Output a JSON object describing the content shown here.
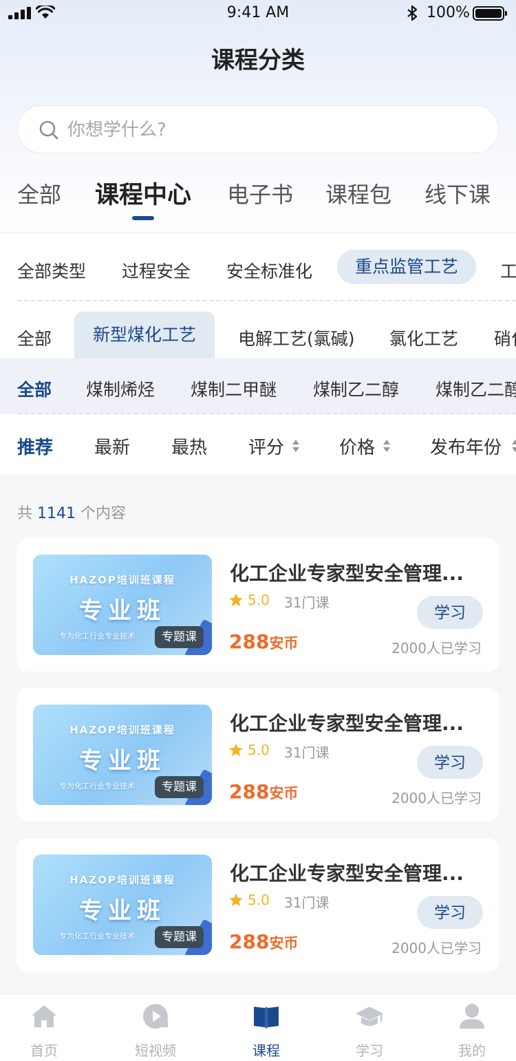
{
  "status_bar": {
    "time": "9:41 AM",
    "battery": "100%"
  },
  "page": {
    "title": "课程分类"
  },
  "search": {
    "placeholder": "你想学什么?"
  },
  "main_tabs": [
    {
      "label": "全部"
    },
    {
      "label": "课程中心"
    },
    {
      "label": "电子书"
    },
    {
      "label": "课程包"
    },
    {
      "label": "线下课"
    }
  ],
  "categories": [
    {
      "label": "全部类型"
    },
    {
      "label": "过程安全"
    },
    {
      "label": "安全标准化"
    },
    {
      "label": "重点监管工艺"
    },
    {
      "label": "工"
    }
  ],
  "sub_categories": [
    {
      "label": "全部"
    },
    {
      "label": "新型煤化工艺"
    },
    {
      "label": "电解工艺(氯碱)"
    },
    {
      "label": "氯化工艺"
    },
    {
      "label": "硝化"
    }
  ],
  "tertiary": [
    {
      "label": "全部"
    },
    {
      "label": "煤制烯烃"
    },
    {
      "label": "煤制二甲醚"
    },
    {
      "label": "煤制乙二醇"
    },
    {
      "label": "煤制乙二醇"
    }
  ],
  "sort": [
    {
      "label": "推荐"
    },
    {
      "label": "最新"
    },
    {
      "label": "最热"
    },
    {
      "label": "评分"
    },
    {
      "label": "价格"
    },
    {
      "label": "发布年份"
    }
  ],
  "result": {
    "prefix": "共",
    "count": "1141",
    "suffix": "个内容"
  },
  "courses": [
    {
      "thumb_line1": "HAZOP培训班课程",
      "thumb_line2": "专业班",
      "thumb_line3": "专为化工行业专业技术",
      "badge": "专题课",
      "title": "化工企业专家型安全管理...",
      "rating": "5.0",
      "lessons": "31门课",
      "price": "288",
      "currency": "安币",
      "button": "学习",
      "learners": "2000人已学习"
    },
    {
      "thumb_line1": "HAZOP培训班课程",
      "thumb_line2": "专业班",
      "thumb_line3": "专为化工行业专业技术",
      "badge": "专题课",
      "title": "化工企业专家型安全管理...",
      "rating": "5.0",
      "lessons": "31门课",
      "price": "288",
      "currency": "安币",
      "button": "学习",
      "learners": "2000人已学习"
    },
    {
      "thumb_line1": "HAZOP培训班课程",
      "thumb_line2": "专业班",
      "thumb_line3": "专为化工行业专业技术",
      "badge": "专题课",
      "title": "化工企业专家型安全管理...",
      "rating": "5.0",
      "lessons": "31门课",
      "price": "288",
      "currency": "安币",
      "button": "学习",
      "learners": "2000人已学习"
    }
  ],
  "bottom_nav": [
    {
      "label": "首页",
      "icon": "home-icon"
    },
    {
      "label": "短视频",
      "icon": "short-video-icon"
    },
    {
      "label": "课程",
      "icon": "book-icon"
    },
    {
      "label": "学习",
      "icon": "graduation-cap-icon"
    },
    {
      "label": "我的",
      "icon": "user-icon"
    }
  ],
  "colors": {
    "accent": "#1a4a8c",
    "price": "#ef6a2a",
    "rating": "#f3b323",
    "chip_bg": "#e1e9f3"
  }
}
